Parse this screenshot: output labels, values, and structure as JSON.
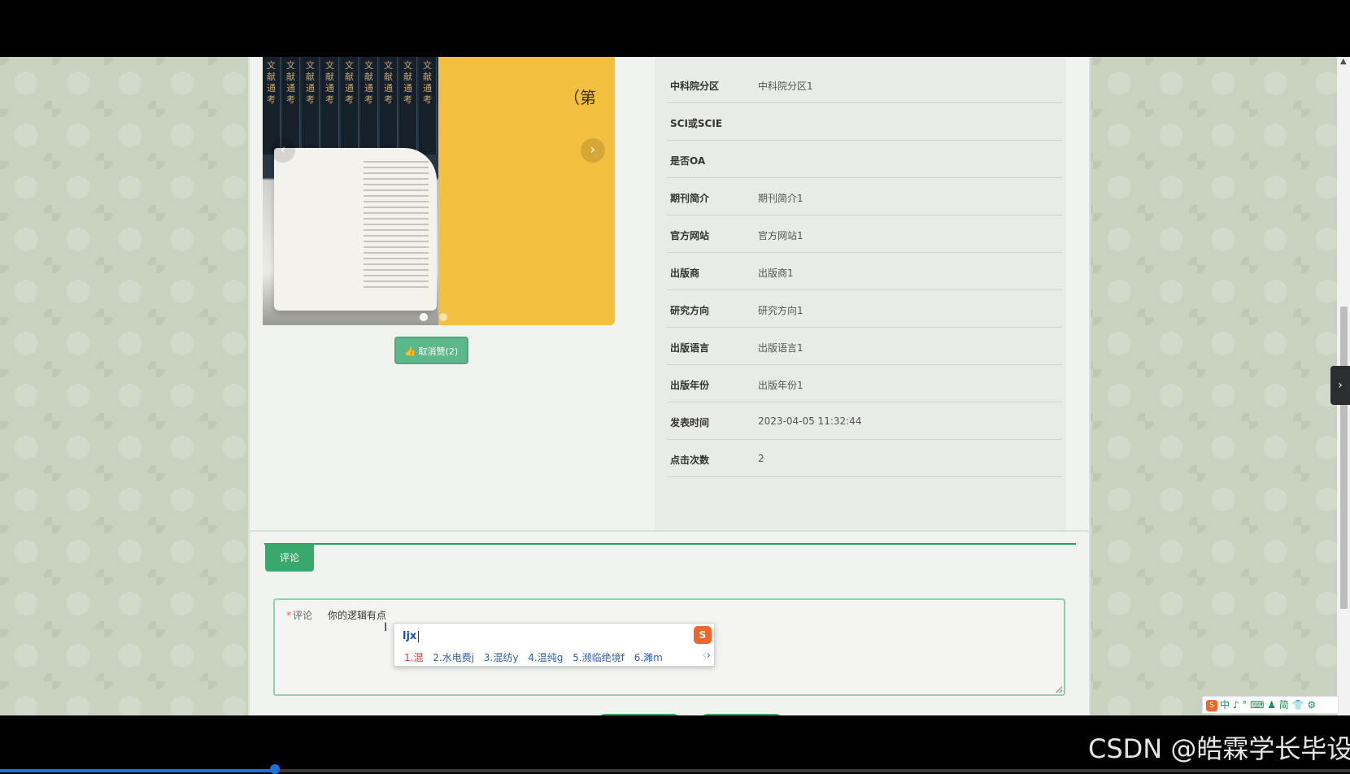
{
  "cover_text": "（第",
  "carousel_arrow_prev": "‹",
  "carousel_arrow_next": "›",
  "like_button": {
    "icon": "thumbs-up-icon",
    "glyph": "👍",
    "label": "取消赞(2)"
  },
  "info_rows": [
    {
      "label": "中科院分区",
      "value": "中科院分区1"
    },
    {
      "label": "SCI或SCIE",
      "value": ""
    },
    {
      "label": "是否OA",
      "value": ""
    },
    {
      "label": "期刊简介",
      "value": "期刊简介1"
    },
    {
      "label": "官方网站",
      "value": "官方网站1"
    },
    {
      "label": "出版商",
      "value": "出版商1"
    },
    {
      "label": "研究方向",
      "value": "研究方向1"
    },
    {
      "label": "出版语言",
      "value": "出版语言1"
    },
    {
      "label": "出版年份",
      "value": "出版年份1"
    },
    {
      "label": "发表时间",
      "value": "2023-04-05 11:32:44"
    },
    {
      "label": "点击次数",
      "value": "2"
    }
  ],
  "comment_tab": "评论",
  "comment_form": {
    "required_mark": "*",
    "label": "评论",
    "value": "你的逻辑有点"
  },
  "ime": {
    "input": "ljx",
    "logo": "S",
    "candidates": [
      "1.混",
      "2.水电费j",
      "3.混纺y",
      "4.温纯g",
      "5.濒临绝境f",
      "6.濉m"
    ],
    "prev": "‹",
    "next": "›"
  },
  "side_toggle": "›",
  "scroll_up": "▲",
  "ime_tray": {
    "logo": "S",
    "text": "中 ♪ ° ⌨ ♟ 简 👕 ⚙"
  },
  "watermark": "CSDN @皓霖学长毕设",
  "colors": {
    "accent_green": "#39a86c",
    "like_button": "#5cb88a",
    "progress": "#1a73d9"
  }
}
